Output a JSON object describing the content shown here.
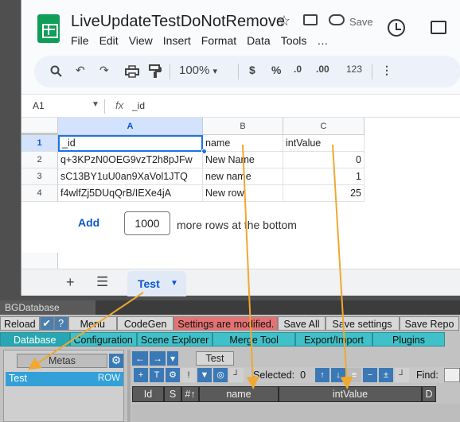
{
  "sheets": {
    "title": "LiveUpdateTestDoNotRemove",
    "save_label": "Save",
    "menu": [
      "File",
      "Edit",
      "View",
      "Insert",
      "Format",
      "Data",
      "Tools",
      "…"
    ],
    "toolbar": {
      "zoom": "100%",
      "zoom_arrow": "▾",
      "currency": "$",
      "percent": "%",
      "dec_minus": ".0",
      "dec_plus": ".00",
      "number_format": "123",
      "more": "⋮"
    },
    "formula_bar": {
      "cell_ref": "A1",
      "fx": "fx",
      "value": "_id"
    },
    "columns": [
      "A",
      "B",
      "C"
    ],
    "rows": [
      {
        "num": "1",
        "cells": [
          "_id",
          "name",
          "intValue"
        ]
      },
      {
        "num": "2",
        "cells": [
          "q+3KPzN0OEG9vzT2h8pJFw",
          "New Name",
          "0"
        ]
      },
      {
        "num": "3",
        "cells": [
          "sC13BY1uU0an9XaVol1JTQ",
          "new name",
          "1"
        ]
      },
      {
        "num": "4",
        "cells": [
          "f4wlfZj5DUqQrB/IEXe4jA",
          "New row",
          "25"
        ]
      }
    ],
    "add_rows": {
      "button": "Add",
      "count": "1000",
      "suffix": "more rows at the bottom"
    },
    "sheet_tab": "Test"
  },
  "unity": {
    "window_title": "BGDatabase",
    "toolbar": [
      "Reload",
      "Menu",
      "CodeGen",
      "Settings are modified.",
      "Save All",
      "Save settings",
      "Save Repo"
    ],
    "tabs": [
      "Database",
      "Configuration",
      "Scene Explorer",
      "Merge Tool",
      "Export/Import",
      "Plugins"
    ],
    "metas_label": "Metas",
    "meta": {
      "name": "Test",
      "type": "ROW"
    },
    "table_tab": "Test",
    "selected_label": "Selected:",
    "selected_count": "0",
    "find_label": "Find:",
    "columns": [
      "Id",
      "S",
      "#↑",
      "name",
      "intValue",
      "D"
    ]
  },
  "colors": {
    "sheets_accent": "#0b57d0",
    "sheets_logo": "#0f9d58",
    "unity_tab": "#40c0c8",
    "unity_icon": "#3a78b6",
    "warning": "#e47272",
    "arrow": "#f0a830"
  },
  "icons": {
    "search": "search-icon",
    "undo": "undo-icon",
    "redo": "redo-icon",
    "print": "print-icon",
    "paint_format": "paint-format-icon",
    "history": "history-icon",
    "comment": "comment-icon",
    "star": "star-icon",
    "gear": "gear-icon"
  }
}
